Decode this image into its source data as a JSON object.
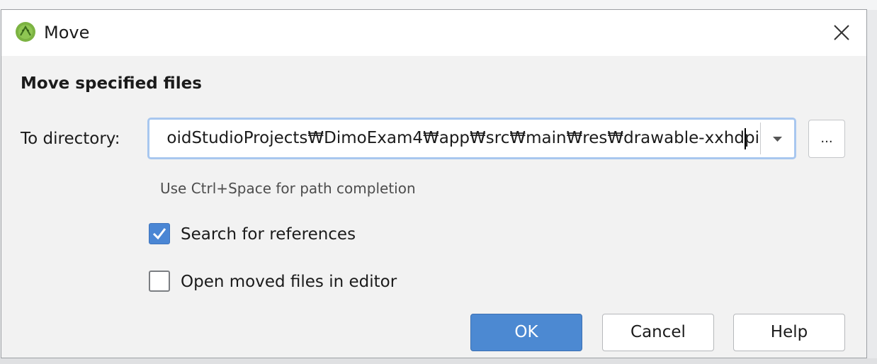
{
  "window": {
    "title": "Move",
    "icon": "android-studio-icon",
    "close_icon": "close-icon"
  },
  "heading": "Move specified files",
  "directory": {
    "label": "To directory:",
    "value": "oidStudioProjects₩DimoExam4₩app₩src₩main₩res₩drawable-xxhdpi",
    "dropdown_icon": "triangle-down-icon",
    "browse_label": "...",
    "hint": "Use Ctrl+Space for path completion"
  },
  "options": {
    "search_references": {
      "label": "Search for references",
      "checked": true
    },
    "open_in_editor": {
      "label": "Open moved files in editor",
      "checked": false
    }
  },
  "buttons": {
    "ok": "OK",
    "cancel": "Cancel",
    "help": "Help"
  },
  "colors": {
    "accent": "#4c89d2",
    "focus_border": "#a8c7ef",
    "dialog_bg": "#f2f2f2"
  }
}
